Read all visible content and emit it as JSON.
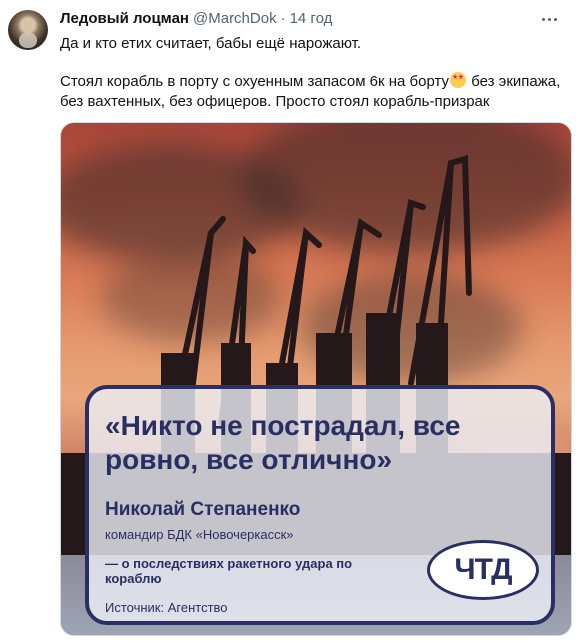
{
  "tweet": {
    "display_name": "Ледовый лоцман",
    "handle": "@MarchDok",
    "separator": "·",
    "time": "14 год",
    "line1": "Да и кто етих считает, бабы ещё нарожают.",
    "line2a": "Стоял корабль в порту с охуенным запасом 6к на борту",
    "line2b": " без экипажа,",
    "line3": "без вахтенных, без офицеров.  Просто стоял корабль-призрак"
  },
  "icons": {
    "avatar": "avatar-image",
    "more": "more-options-icon",
    "emoji": "star-struck-emoji"
  },
  "media": {
    "quote": "«Никто не пострадал, все ровно, все отлично»",
    "person": "Николай Степаненко",
    "role": "командир БДК «Новочеркасск»",
    "context": "— о последствиях ракетного удара по кораблю",
    "source": "Источник: Агентство",
    "logo": "ЧТД"
  },
  "colors": {
    "text": "#0f1419",
    "secondary": "#536471",
    "card_accent": "#2a2f63"
  }
}
